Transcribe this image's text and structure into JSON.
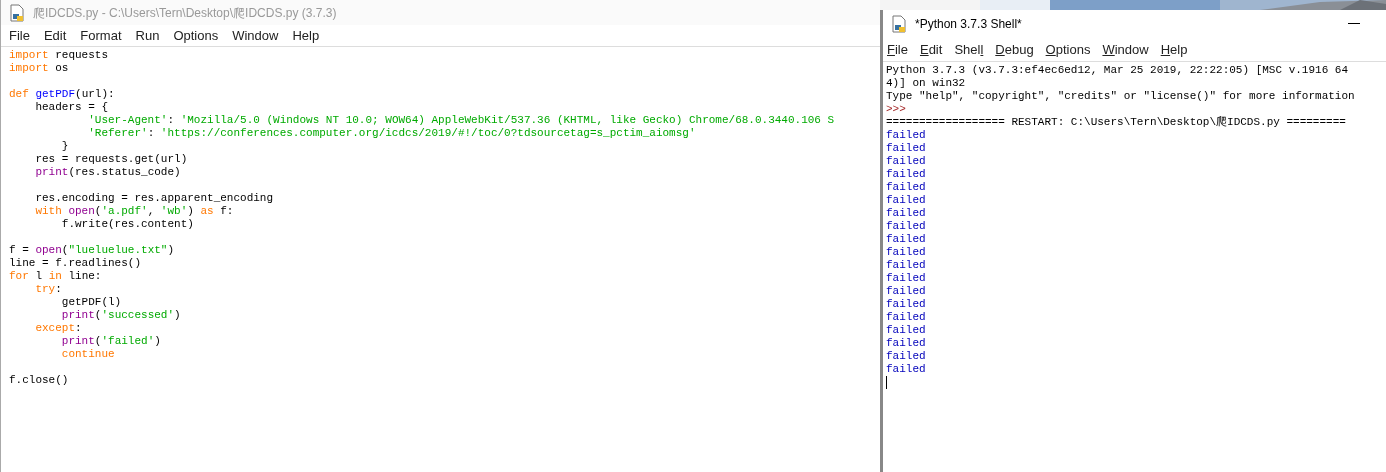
{
  "editor": {
    "title": "爬IDCDS.py - C:\\Users\\Tern\\Desktop\\爬IDCDS.py (3.7.3)",
    "active": false,
    "menu": [
      "File",
      "Edit",
      "Format",
      "Run",
      "Options",
      "Window",
      "Help"
    ],
    "code": [
      {
        "kind": "code",
        "tokens": [
          {
            "kind": "keyword",
            "text": "import"
          },
          {
            "kind": "plain",
            "text": " requests"
          }
        ]
      },
      {
        "kind": "code",
        "tokens": [
          {
            "kind": "keyword",
            "text": "import"
          },
          {
            "kind": "plain",
            "text": " os"
          }
        ]
      },
      {
        "kind": "blank"
      },
      {
        "kind": "code",
        "tokens": [
          {
            "kind": "keyword",
            "text": "def"
          },
          {
            "kind": "definition",
            "text": " getPDF"
          },
          {
            "kind": "plain",
            "text": "(url):"
          }
        ]
      },
      {
        "kind": "code",
        "tokens": [
          {
            "kind": "plain",
            "text": "    headers = {"
          }
        ]
      },
      {
        "kind": "code",
        "tokens": [
          {
            "kind": "string",
            "text": "            'User-Agent'"
          },
          {
            "kind": "plain",
            "text": ": "
          },
          {
            "kind": "string",
            "text": "'Mozilla/5.0 (Windows NT 10.0; WOW64) AppleWebKit/537.36 (KHTML, like Gecko) Chrome/68.0.3440.106 S"
          }
        ]
      },
      {
        "kind": "code",
        "tokens": [
          {
            "kind": "string",
            "text": "            'Referer'"
          },
          {
            "kind": "plain",
            "text": ": "
          },
          {
            "kind": "string",
            "text": "'https://conferences.computer.org/icdcs/2019/#!/toc/0?tdsourcetag=s_pctim_aiomsg'"
          }
        ]
      },
      {
        "kind": "code",
        "tokens": [
          {
            "kind": "plain",
            "text": "        }"
          }
        ]
      },
      {
        "kind": "code",
        "tokens": [
          {
            "kind": "plain",
            "text": "    res = requests.get(url)"
          }
        ]
      },
      {
        "kind": "code",
        "tokens": [
          {
            "kind": "builtin",
            "text": "    print"
          },
          {
            "kind": "plain",
            "text": "(res.status_code)"
          }
        ]
      },
      {
        "kind": "blank"
      },
      {
        "kind": "code",
        "tokens": [
          {
            "kind": "plain",
            "text": "    res.encoding = res.apparent_encoding"
          }
        ]
      },
      {
        "kind": "code",
        "tokens": [
          {
            "kind": "keyword",
            "text": "    with"
          },
          {
            "kind": "builtin",
            "text": " open"
          },
          {
            "kind": "plain",
            "text": "("
          },
          {
            "kind": "string",
            "text": "'a.pdf'"
          },
          {
            "kind": "plain",
            "text": ", "
          },
          {
            "kind": "string",
            "text": "'wb'"
          },
          {
            "kind": "plain",
            "text": ") "
          },
          {
            "kind": "keyword",
            "text": "as"
          },
          {
            "kind": "plain",
            "text": " f:"
          }
        ]
      },
      {
        "kind": "code",
        "tokens": [
          {
            "kind": "plain",
            "text": "        f.write(res.content)"
          }
        ]
      },
      {
        "kind": "blank"
      },
      {
        "kind": "code",
        "tokens": [
          {
            "kind": "plain",
            "text": "f = "
          },
          {
            "kind": "builtin",
            "text": "open"
          },
          {
            "kind": "plain",
            "text": "("
          },
          {
            "kind": "string",
            "text": "\"lueluelue.txt\""
          },
          {
            "kind": "plain",
            "text": ")"
          }
        ]
      },
      {
        "kind": "code",
        "tokens": [
          {
            "kind": "plain",
            "text": "line = f.readlines()"
          }
        ]
      },
      {
        "kind": "code",
        "tokens": [
          {
            "kind": "keyword",
            "text": "for"
          },
          {
            "kind": "plain",
            "text": " l "
          },
          {
            "kind": "keyword",
            "text": "in"
          },
          {
            "kind": "plain",
            "text": " line:"
          }
        ]
      },
      {
        "kind": "code",
        "tokens": [
          {
            "kind": "keyword",
            "text": "    try"
          },
          {
            "kind": "plain",
            "text": ":"
          }
        ]
      },
      {
        "kind": "code",
        "tokens": [
          {
            "kind": "plain",
            "text": "        getPDF(l)"
          }
        ]
      },
      {
        "kind": "code",
        "tokens": [
          {
            "kind": "builtin",
            "text": "        print"
          },
          {
            "kind": "plain",
            "text": "("
          },
          {
            "kind": "string",
            "text": "'successed'"
          },
          {
            "kind": "plain",
            "text": ")"
          }
        ]
      },
      {
        "kind": "code",
        "tokens": [
          {
            "kind": "keyword",
            "text": "    except"
          },
          {
            "kind": "plain",
            "text": ":"
          }
        ]
      },
      {
        "kind": "code",
        "tokens": [
          {
            "kind": "builtin",
            "text": "        print"
          },
          {
            "kind": "plain",
            "text": "("
          },
          {
            "kind": "string",
            "text": "'failed'"
          },
          {
            "kind": "plain",
            "text": ")"
          }
        ]
      },
      {
        "kind": "code",
        "tokens": [
          {
            "kind": "keyword",
            "text": "        continue"
          }
        ]
      },
      {
        "kind": "blank"
      },
      {
        "kind": "code",
        "tokens": [
          {
            "kind": "plain",
            "text": "f.close()"
          }
        ]
      }
    ]
  },
  "shell": {
    "title": "*Python 3.7.3 Shell*",
    "active": true,
    "menu": [
      {
        "parts": [
          {
            "text": "F",
            "underlined": true
          },
          {
            "text": "ile",
            "underlined": false
          }
        ]
      },
      {
        "parts": [
          {
            "text": "E",
            "underlined": true
          },
          {
            "text": "dit",
            "underlined": false
          }
        ]
      },
      {
        "parts": [
          {
            "text": "Shel",
            "underlined": false
          },
          {
            "text": "l",
            "underlined": true
          }
        ]
      },
      {
        "parts": [
          {
            "text": "D",
            "underlined": true
          },
          {
            "text": "ebug",
            "underlined": false
          }
        ]
      },
      {
        "parts": [
          {
            "text": "O",
            "underlined": true
          },
          {
            "text": "ptions",
            "underlined": false
          }
        ]
      },
      {
        "parts": [
          {
            "text": "W",
            "underlined": true
          },
          {
            "text": "indow",
            "underlined": false
          }
        ]
      },
      {
        "parts": [
          {
            "text": "H",
            "underlined": true
          },
          {
            "text": "elp",
            "underlined": false
          }
        ]
      }
    ],
    "output": [
      {
        "kind": "banner",
        "text": "Python 3.7.3 (v3.7.3:ef4ec6ed12, Mar 25 2019, 22:22:05) [MSC v.1916 64"
      },
      {
        "kind": "banner",
        "text": "4)] on win32"
      },
      {
        "kind": "banner",
        "text": "Type \"help\", \"copyright\", \"credits\" or \"license()\" for more information"
      },
      {
        "kind": "prompt",
        "text": ">>>"
      },
      {
        "kind": "banner",
        "text": "================== RESTART: C:\\Users\\Tern\\Desktop\\爬IDCDS.py ========="
      },
      {
        "kind": "stdout",
        "text": "failed"
      },
      {
        "kind": "stdout",
        "text": "failed"
      },
      {
        "kind": "stdout",
        "text": "failed"
      },
      {
        "kind": "stdout",
        "text": "failed"
      },
      {
        "kind": "stdout",
        "text": "failed"
      },
      {
        "kind": "stdout",
        "text": "failed"
      },
      {
        "kind": "stdout",
        "text": "failed"
      },
      {
        "kind": "stdout",
        "text": "failed"
      },
      {
        "kind": "stdout",
        "text": "failed"
      },
      {
        "kind": "stdout",
        "text": "failed"
      },
      {
        "kind": "stdout",
        "text": "failed"
      },
      {
        "kind": "stdout",
        "text": "failed"
      },
      {
        "kind": "stdout",
        "text": "failed"
      },
      {
        "kind": "stdout",
        "text": "failed"
      },
      {
        "kind": "stdout",
        "text": "failed"
      },
      {
        "kind": "stdout",
        "text": "failed"
      },
      {
        "kind": "stdout",
        "text": "failed"
      },
      {
        "kind": "stdout",
        "text": "failed"
      },
      {
        "kind": "stdout",
        "text": "failed"
      }
    ]
  }
}
